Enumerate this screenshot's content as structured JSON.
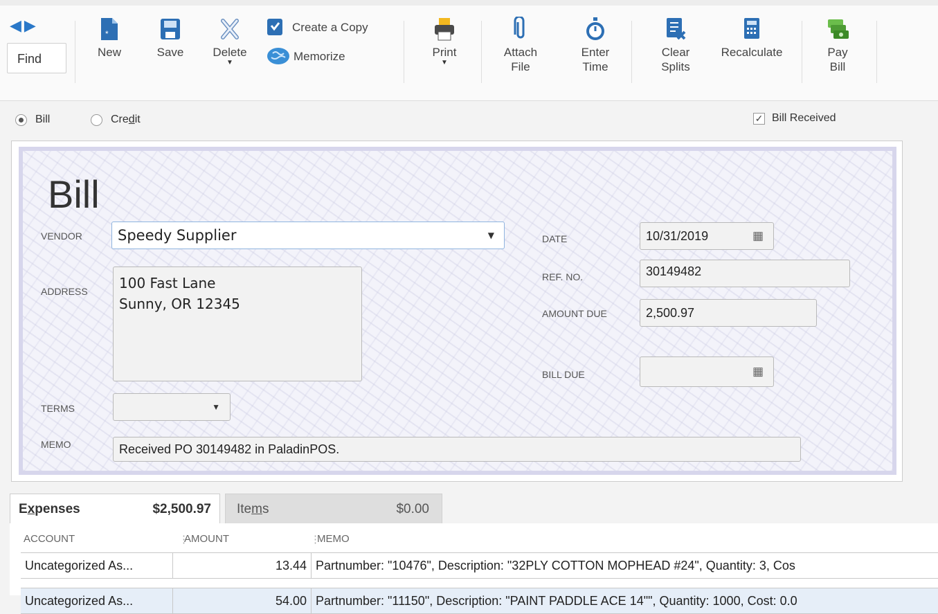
{
  "toolbar": {
    "find": "Find",
    "new": "New",
    "save": "Save",
    "delete": "Delete",
    "create_copy": "Create a Copy",
    "memorize": "Memorize",
    "print": "Print",
    "attach_file_1": "Attach",
    "attach_file_2": "File",
    "enter_time_1": "Enter",
    "enter_time_2": "Time",
    "clear_splits_1": "Clear",
    "clear_splits_2": "Splits",
    "recalculate": "Recalculate",
    "pay_bill_1": "Pay",
    "pay_bill_2": "Bill"
  },
  "type_select": {
    "bill": "Bill",
    "credit_prefix": "Cre",
    "credit_underlined": "d",
    "credit_suffix": "it",
    "selected": "Bill",
    "bill_received": "Bill Received",
    "bill_received_checked": true
  },
  "form": {
    "title": "Bill",
    "vendor_label": "VENDOR",
    "vendor": "Speedy Supplier",
    "address_label": "ADDRESS",
    "address_line1": "100 Fast Lane",
    "address_line2": "Sunny, OR 12345",
    "terms_label": "TERMS",
    "terms": "",
    "memo_label": "MEMO",
    "memo": "Received PO 30149482 in PaladinPOS.",
    "date_label": "DATE",
    "date": "10/31/2019",
    "ref_label": "REF. NO.",
    "ref_no": "30149482",
    "amount_due_label": "AMOUNT DUE",
    "amount_due": "2,500.97",
    "bill_due_label": "BILL DUE",
    "bill_due": ""
  },
  "tabs": {
    "expenses_prefix": "E",
    "expenses_underlined": "x",
    "expenses_suffix": "penses",
    "expenses_amount": "$2,500.97",
    "items_prefix": "Ite",
    "items_underlined": "m",
    "items_suffix": "s",
    "items_amount": "$0.00"
  },
  "table": {
    "headers": [
      "ACCOUNT",
      "AMOUNT",
      "MEMO"
    ],
    "rows": [
      {
        "account": "Uncategorized As...",
        "amount": "13.44",
        "memo": "Partnumber: \"10476\", Description: \"32PLY COTTON MOPHEAD #24\", Quantity: 3, Cos"
      },
      {
        "account": "Uncategorized As...",
        "amount": "54.00",
        "memo": "Partnumber: \"11150\", Description: \"PAINT PADDLE ACE 14\"\", Quantity: 1000, Cost: 0.0"
      }
    ]
  }
}
